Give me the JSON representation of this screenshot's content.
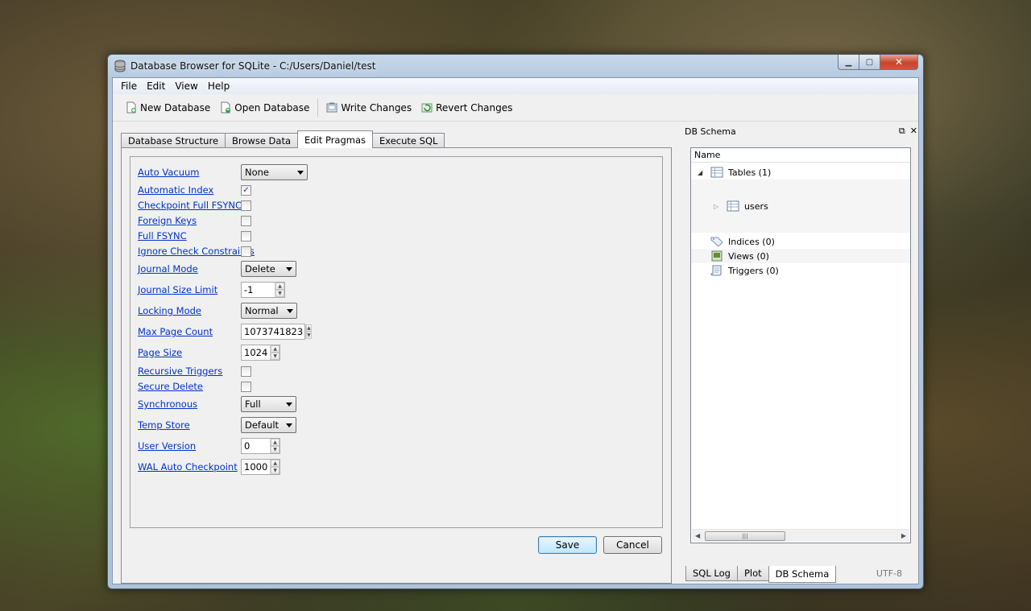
{
  "window": {
    "title": "Database Browser for SQLite - C:/Users/Daniel/test"
  },
  "menu": [
    "File",
    "Edit",
    "View",
    "Help"
  ],
  "toolbar": {
    "new_database": "New Database",
    "open_database": "Open Database",
    "write_changes": "Write Changes",
    "revert_changes": "Revert Changes"
  },
  "tabs": [
    "Database Structure",
    "Browse Data",
    "Edit Pragmas",
    "Execute SQL"
  ],
  "active_tab": "Edit Pragmas",
  "pragmas": {
    "auto_vacuum": {
      "label": "Auto Vacuum",
      "value": "None"
    },
    "automatic_index": {
      "label": "Automatic Index",
      "checked": true
    },
    "checkpoint_full_fsync": {
      "label": "Checkpoint Full FSYNC",
      "checked": false
    },
    "foreign_keys": {
      "label": "Foreign Keys",
      "checked": false
    },
    "full_fsync": {
      "label": "Full FSYNC",
      "checked": false
    },
    "ignore_check_constraints": {
      "label": "Ignore Check Constraints",
      "checked": false
    },
    "journal_mode": {
      "label": "Journal Mode",
      "value": "Delete"
    },
    "journal_size_limit": {
      "label": "Journal Size Limit",
      "value": "-1"
    },
    "locking_mode": {
      "label": "Locking Mode",
      "value": "Normal"
    },
    "max_page_count": {
      "label": "Max Page Count",
      "value": "1073741823"
    },
    "page_size": {
      "label": "Page Size",
      "value": "1024"
    },
    "recursive_triggers": {
      "label": "Recursive Triggers",
      "checked": false
    },
    "secure_delete": {
      "label": "Secure Delete",
      "checked": false
    },
    "synchronous": {
      "label": "Synchronous",
      "value": "Full"
    },
    "temp_store": {
      "label": "Temp Store",
      "value": "Default"
    },
    "user_version": {
      "label": "User Version",
      "value": "0"
    },
    "wal_auto_checkpoint": {
      "label": "WAL Auto Checkpoint",
      "value": "1000"
    }
  },
  "buttons": {
    "save": "Save",
    "cancel": "Cancel"
  },
  "schema": {
    "title": "DB Schema",
    "column": "Name",
    "tables": "Tables (1)",
    "users": "users",
    "indices": "Indices (0)",
    "views": "Views (0)",
    "triggers": "Triggers (0)"
  },
  "dock_tabs": [
    "SQL Log",
    "Plot",
    "DB Schema"
  ],
  "status": {
    "encoding": "UTF-8"
  },
  "colors": {
    "link": "#0033cc",
    "title_gradient": "#b4c9e0",
    "close_button": "#c7442a"
  }
}
